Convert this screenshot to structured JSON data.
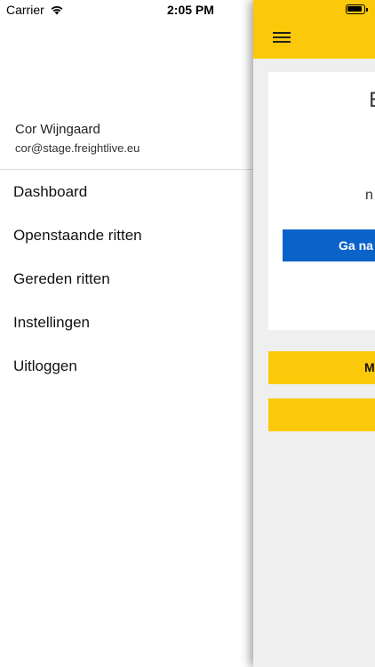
{
  "status_bar": {
    "carrier": "Carrier",
    "time": "2:05 PM"
  },
  "drawer": {
    "user_name": "Cor Wijngaard",
    "user_email": "cor@stage.freightlive.eu",
    "menu_items": [
      {
        "label": "Dashboard"
      },
      {
        "label": "Openstaande ritten"
      },
      {
        "label": "Gereden ritten"
      },
      {
        "label": "Instellingen"
      },
      {
        "label": "Uitloggen"
      }
    ]
  },
  "main": {
    "card_heading": "E",
    "card_text": "n",
    "primary_button": "Ga na",
    "secondary_button": "M",
    "tertiary_button": ""
  },
  "colors": {
    "accent": "#fcc90a",
    "primary": "#0a63c9",
    "background": "#efefef"
  }
}
